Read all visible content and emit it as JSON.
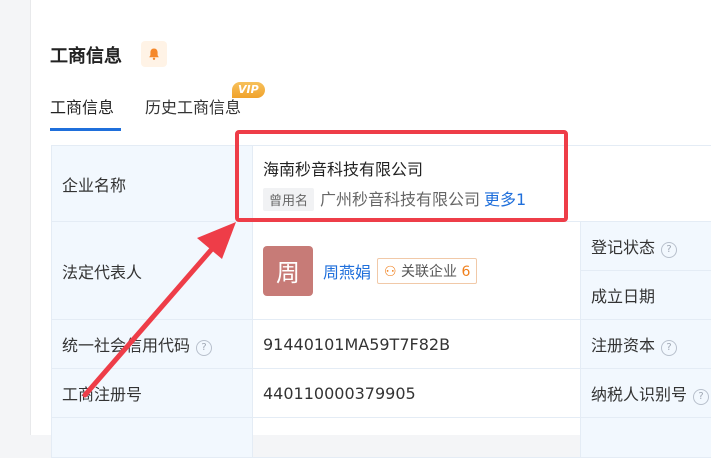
{
  "section": {
    "title": "工商信息"
  },
  "tabs": {
    "active": "工商信息",
    "history": "历史工商信息",
    "vip_badge": "VIP"
  },
  "rows": {
    "company_label": "企业名称",
    "company_name": "海南秒音科技有限公司",
    "former_tag": "曾用名",
    "former_name": "广州秒音科技有限公司",
    "more": "更多1",
    "legal_label": "法定代表人",
    "avatar_char": "周",
    "legal_name": "周燕娟",
    "related_label": "关联企业",
    "related_count": "6",
    "reg_status_label": "登记状态",
    "established_label": "成立日期",
    "credit_label": "统一社会信用代码",
    "credit_value": "91440101MA59T7F82B",
    "capital_label": "注册资本",
    "regno_label": "工商注册号",
    "regno_value": "440110000379905",
    "taxpayer_label": "纳税人识别号"
  },
  "colors": {
    "accent": "#1f6fdb",
    "highlight": "#ee3d48",
    "label_bg": "#f2f8fe"
  }
}
